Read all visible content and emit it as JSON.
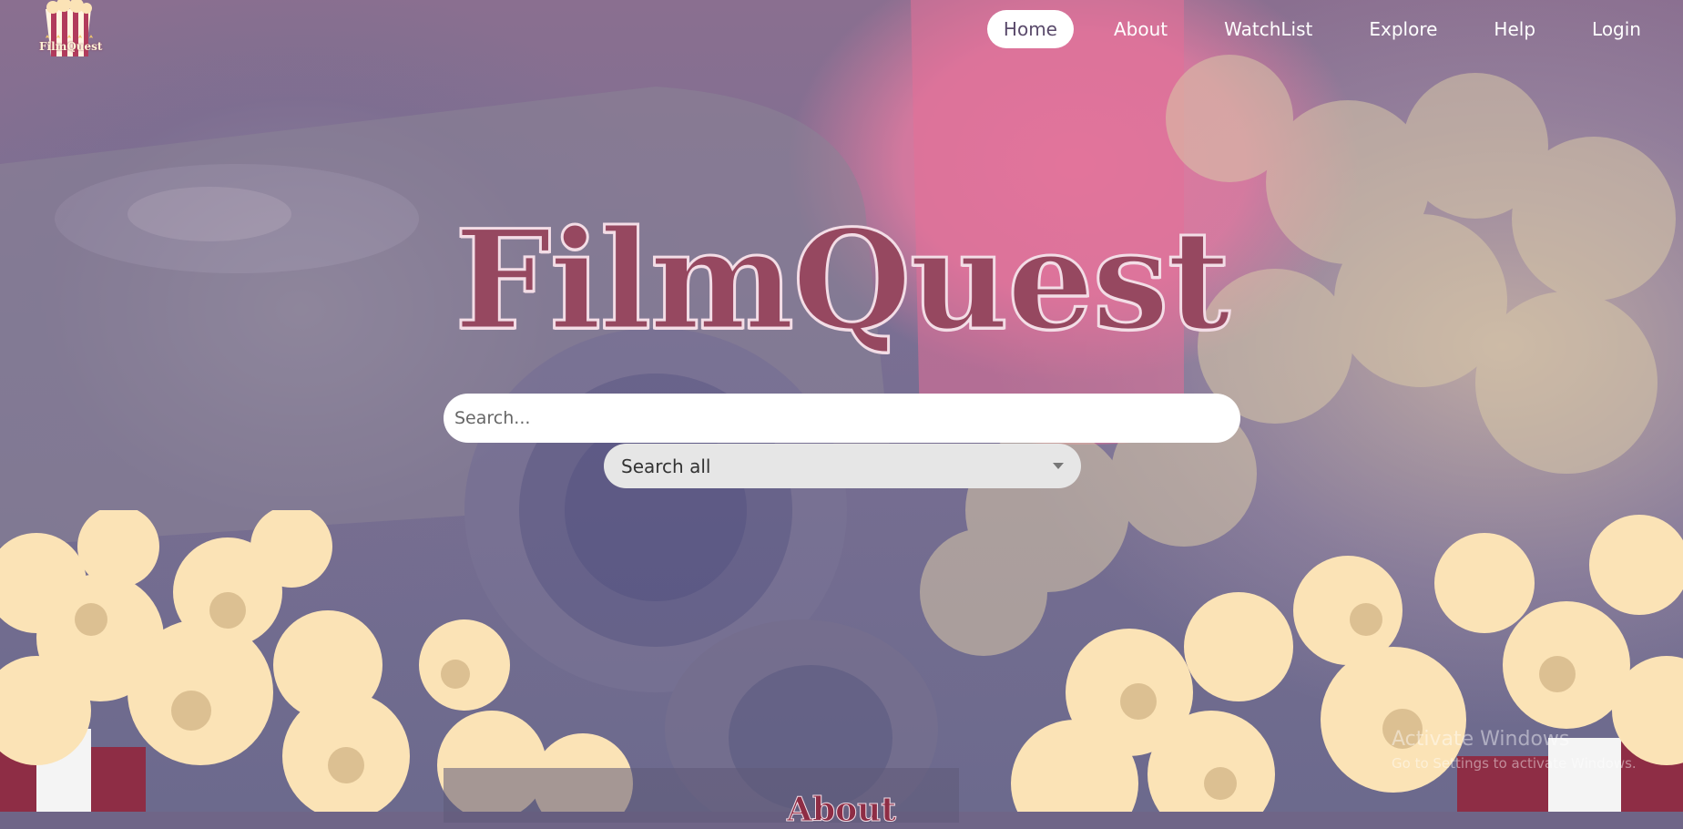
{
  "site": {
    "logo_text": "FilmQuest",
    "title": "FilmQuest"
  },
  "nav": {
    "items": [
      {
        "label": "Home",
        "active": true
      },
      {
        "label": "About",
        "active": false
      },
      {
        "label": "WatchList",
        "active": false
      },
      {
        "label": "Explore",
        "active": false
      },
      {
        "label": "Help",
        "active": false
      },
      {
        "label": "Login",
        "active": false
      }
    ]
  },
  "search": {
    "placeholder": "Search...",
    "filter_selected": "Search all"
  },
  "sections": {
    "about_heading": "About"
  },
  "watermark": {
    "title": "Activate Windows",
    "subtitle": "Go to Settings to activate Windows."
  },
  "colors": {
    "brand": "#964860",
    "accent_pink": "#e07aa0",
    "popcorn": "#fbe3b6",
    "overlay": "#6f6587"
  },
  "icons": {
    "logo": "popcorn-bucket-icon",
    "dropdown": "caret-down-icon"
  }
}
